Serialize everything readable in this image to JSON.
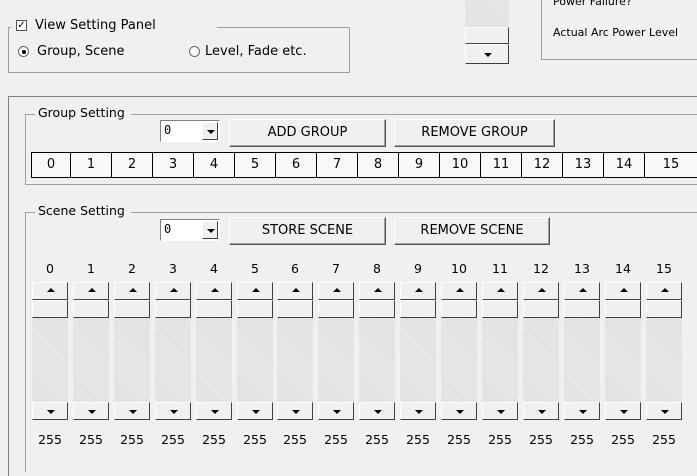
{
  "view_panel": {
    "title": "View Setting Panel",
    "checked": true,
    "check_mark": "✓",
    "options": [
      "Group, Scene",
      "Level, Fade etc."
    ],
    "selected_index": 0
  },
  "right_panel": {
    "line1": "Power Failure?",
    "line2": "Actual Arc Power Level"
  },
  "group_setting": {
    "title": "Group Setting",
    "combo_value": "0",
    "add_label": "ADD GROUP",
    "remove_label": "REMOVE GROUP",
    "groups": [
      "0",
      "1",
      "2",
      "3",
      "4",
      "5",
      "6",
      "7",
      "8",
      "9",
      "10",
      "11",
      "12",
      "13",
      "14",
      "15"
    ]
  },
  "scene_setting": {
    "title": "Scene Setting",
    "combo_value": "0",
    "store_label": "STORE SCENE",
    "remove_label": "REMOVE SCENE",
    "scenes": [
      "0",
      "1",
      "2",
      "3",
      "4",
      "5",
      "6",
      "7",
      "8",
      "9",
      "10",
      "11",
      "12",
      "13",
      "14",
      "15"
    ],
    "values": [
      "255",
      "255",
      "255",
      "255",
      "255",
      "255",
      "255",
      "255",
      "255",
      "255",
      "255",
      "255",
      "255",
      "255",
      "255",
      "255"
    ]
  },
  "icons": {
    "combo_arrow": "chevron-down-icon",
    "scroll_up": "arrow-up-icon",
    "scroll_down": "arrow-down-icon"
  }
}
